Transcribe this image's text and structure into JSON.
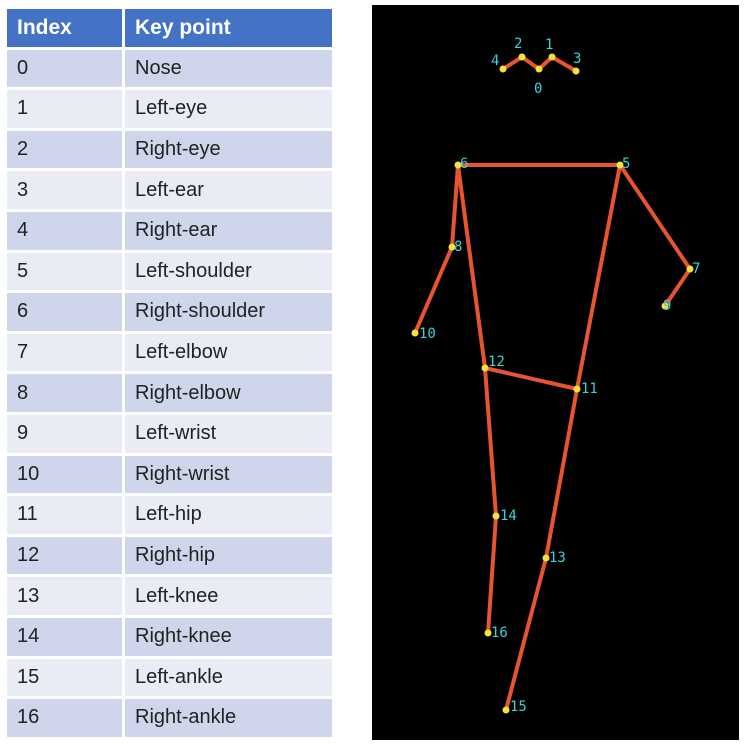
{
  "table": {
    "headers": {
      "index": "Index",
      "keypoint": "Key point"
    },
    "rows": [
      {
        "index": "0",
        "name": "Nose"
      },
      {
        "index": "1",
        "name": "Left-eye"
      },
      {
        "index": "2",
        "name": "Right-eye"
      },
      {
        "index": "3",
        "name": "Left-ear"
      },
      {
        "index": "4",
        "name": "Right-ear"
      },
      {
        "index": "5",
        "name": "Left-shoulder"
      },
      {
        "index": "6",
        "name": "Right-shoulder"
      },
      {
        "index": "7",
        "name": "Left-elbow"
      },
      {
        "index": "8",
        "name": "Right-elbow"
      },
      {
        "index": "9",
        "name": "Left-wrist"
      },
      {
        "index": "10",
        "name": "Right-wrist"
      },
      {
        "index": "11",
        "name": "Left-hip"
      },
      {
        "index": "12",
        "name": "Right-hip"
      },
      {
        "index": "13",
        "name": "Left-knee"
      },
      {
        "index": "14",
        "name": "Right-knee"
      },
      {
        "index": "15",
        "name": "Left-ankle"
      },
      {
        "index": "16",
        "name": "Right-ankle"
      }
    ]
  },
  "skeleton": {
    "keypoint_labels": [
      "0",
      "1",
      "2",
      "3",
      "4",
      "5",
      "6",
      "7",
      "8",
      "9",
      "10",
      "11",
      "12",
      "13",
      "14",
      "15",
      "16"
    ],
    "edges": [
      [
        4,
        2
      ],
      [
        2,
        0
      ],
      [
        0,
        1
      ],
      [
        1,
        3
      ],
      [
        6,
        5
      ],
      [
        6,
        8
      ],
      [
        8,
        10
      ],
      [
        5,
        7
      ],
      [
        7,
        9
      ],
      [
        6,
        12
      ],
      [
        5,
        11
      ],
      [
        12,
        11
      ],
      [
        12,
        14
      ],
      [
        14,
        16
      ],
      [
        11,
        13
      ],
      [
        13,
        15
      ]
    ],
    "colors": {
      "background": "#000000",
      "limb": "#e8542e",
      "joint": "#f5e33a",
      "label": "#39d3d8"
    }
  }
}
